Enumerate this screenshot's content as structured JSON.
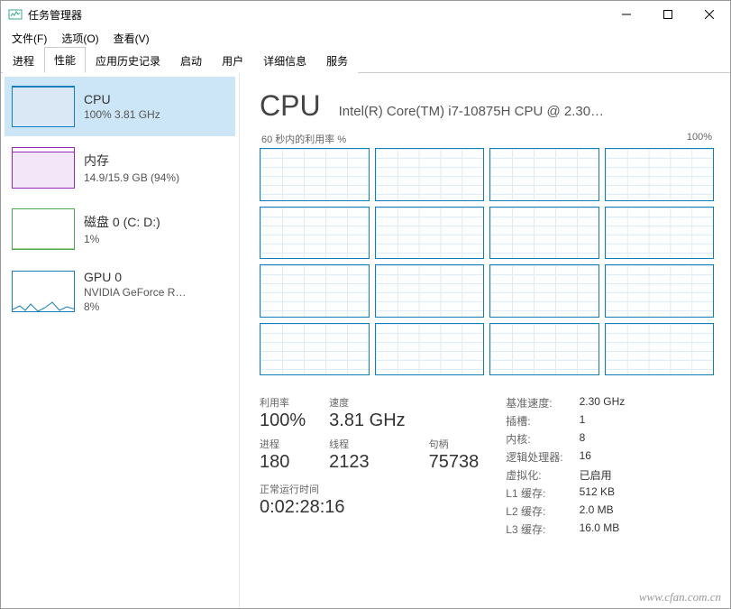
{
  "window": {
    "title": "任务管理器"
  },
  "menu": {
    "file": "文件(F)",
    "options": "选项(O)",
    "view": "查看(V)"
  },
  "tabs": [
    "进程",
    "性能",
    "应用历史记录",
    "启动",
    "用户",
    "详细信息",
    "服务"
  ],
  "sidebar": [
    {
      "name": "CPU",
      "sub": "100% 3.81 GHz",
      "kind": "cpu",
      "selected": true
    },
    {
      "name": "内存",
      "sub": "14.9/15.9 GB (94%)",
      "kind": "mem",
      "selected": false
    },
    {
      "name": "磁盘 0 (C: D:)",
      "sub": "1%",
      "kind": "disk",
      "selected": false
    },
    {
      "name": "GPU 0",
      "sub": "NVIDIA GeForce R…",
      "sub2": "8%",
      "kind": "gpu",
      "selected": false
    }
  ],
  "detail": {
    "heading": "CPU",
    "model": "Intel(R) Core(TM) i7-10875H CPU @ 2.30…",
    "graph_label_left": "60 秒内的利用率 %",
    "graph_label_right": "100%",
    "metrics": {
      "util_label": "利用率",
      "util": "100%",
      "speed_label": "速度",
      "speed": "3.81 GHz",
      "proc_label": "进程",
      "proc": "180",
      "thread_label": "线程",
      "thread": "2123",
      "handle_label": "句柄",
      "handle": "75738",
      "uptime_label": "正常运行时间",
      "uptime": "0:02:28:16"
    },
    "info": {
      "base_label": "基准速度:",
      "base": "2.30 GHz",
      "sockets_label": "插槽:",
      "sockets": "1",
      "cores_label": "内核:",
      "cores": "8",
      "lp_label": "逻辑处理器:",
      "lp": "16",
      "virt_label": "虚拟化:",
      "virt": "已启用",
      "l1_label": "L1 缓存:",
      "l1": "512 KB",
      "l2_label": "L2 缓存:",
      "l2": "2.0 MB",
      "l3_label": "L3 缓存:",
      "l3": "16.0 MB"
    }
  },
  "watermark": "www.cfan.com.cn",
  "chart_data": {
    "type": "area",
    "title": "60 秒内的利用率 %",
    "note": "16 small per-logical-processor charts shown as a 4x4 grid; individual values not numerically labeled in screenshot",
    "processors": 16,
    "ylim": [
      0,
      100
    ],
    "window_seconds": 60
  }
}
